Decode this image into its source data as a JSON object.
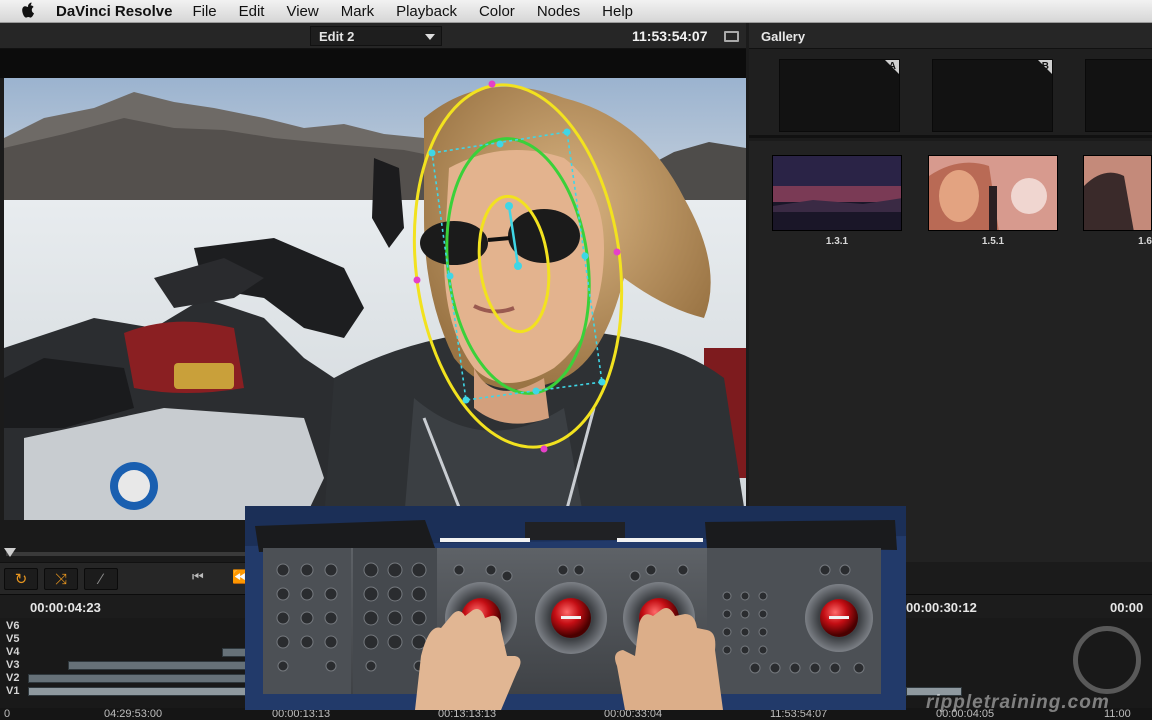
{
  "menubar": {
    "app": "DaVinci Resolve",
    "items": [
      "File",
      "Edit",
      "View",
      "Mark",
      "Playback",
      "Color",
      "Nodes",
      "Help"
    ]
  },
  "viewer": {
    "timeline_name": "Edit 2",
    "timecode": "11:53:54:07"
  },
  "gallery": {
    "title": "Gallery",
    "memory_slots": [
      "A",
      "B"
    ],
    "stills": [
      "1.3.1",
      "1.5.1",
      "1.6"
    ]
  },
  "timeline": {
    "ruler_timecodes": [
      "00:00:04:23",
      "00:00:30:12",
      "00:00"
    ],
    "tracks": [
      "V6",
      "V5",
      "V4",
      "V3",
      "V2",
      "V1"
    ],
    "bottom_timecodes": [
      "0",
      "04:29:53:00",
      "00:00:13:13",
      "00:13:13:13",
      "00:00:33:04",
      "11:53:54:07",
      "00:00:04:05",
      "11:00"
    ]
  },
  "watermark": "rippletraining.com",
  "colors": {
    "accent": "#e8961f",
    "window_outer": "#f2e21f",
    "window_inner": "#3ad13a",
    "tracker": "#3fd6e6",
    "handle": "#e640c8"
  }
}
